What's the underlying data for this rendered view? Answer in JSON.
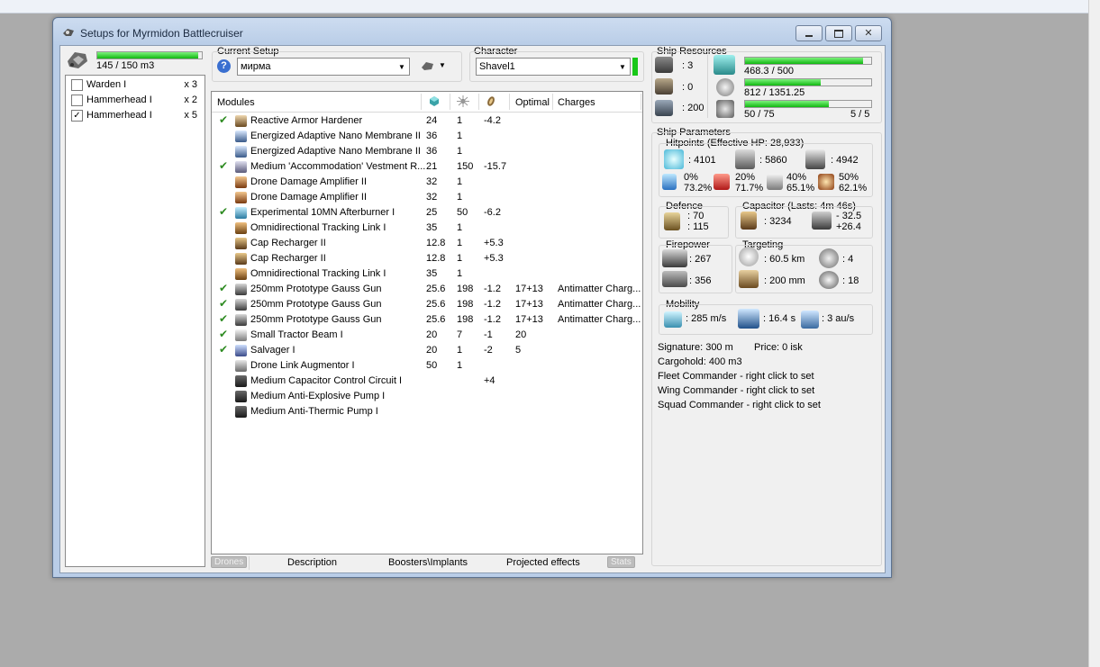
{
  "window": {
    "title": "Setups for Myrmidon Battlecruiser",
    "controls": [
      "minimize",
      "maximize",
      "close"
    ]
  },
  "drone_bay": {
    "capacity_text": "145 / 150 m3",
    "capacity_fraction": 0.967,
    "drones": [
      {
        "name": "Warden I",
        "qty": "x 3",
        "checked": false
      },
      {
        "name": "Hammerhead I",
        "qty": "x 2",
        "checked": false
      },
      {
        "name": "Hammerhead I",
        "qty": "x 5",
        "checked": true
      }
    ]
  },
  "setup": {
    "label": "Current Setup",
    "value": "мирма",
    "help_icon": "question-icon",
    "tools_icon": "drone-tools-icon"
  },
  "character": {
    "label": "Character",
    "value": "Shavel1",
    "status_color": "#18c818"
  },
  "modules": {
    "headers": {
      "name": "Modules",
      "optimal": "Optimal",
      "charges": "Charges",
      "col_icons": [
        "cpu-icon",
        "powergrid-icon",
        "capacitor-icon"
      ]
    },
    "rows": [
      {
        "active": true,
        "icon": "armor-hardener-icon",
        "name": "Reactive Armor Hardener",
        "cpu": "24",
        "pg": "1",
        "cap": "-4.2",
        "optimal": "",
        "charges": ""
      },
      {
        "active": false,
        "icon": "membrane-icon",
        "name": "Energized Adaptive Nano Membrane II",
        "cpu": "36",
        "pg": "1",
        "cap": "",
        "optimal": "",
        "charges": ""
      },
      {
        "active": false,
        "icon": "membrane-icon",
        "name": "Energized Adaptive Nano Membrane II",
        "cpu": "36",
        "pg": "1",
        "cap": "",
        "optimal": "",
        "charges": ""
      },
      {
        "active": true,
        "icon": "vestment-reconstructor-icon",
        "name": "Medium 'Accommodation' Vestment R...",
        "cpu": "21",
        "pg": "150",
        "cap": "-15.7",
        "optimal": "",
        "charges": ""
      },
      {
        "active": false,
        "icon": "drone-damage-amplifier-icon",
        "name": "Drone Damage Amplifier II",
        "cpu": "32",
        "pg": "1",
        "cap": "",
        "optimal": "",
        "charges": ""
      },
      {
        "active": false,
        "icon": "drone-damage-amplifier-icon",
        "name": "Drone Damage Amplifier II",
        "cpu": "32",
        "pg": "1",
        "cap": "",
        "optimal": "",
        "charges": ""
      },
      {
        "active": true,
        "icon": "afterburner-icon",
        "name": "Experimental 10MN Afterburner I",
        "cpu": "25",
        "pg": "50",
        "cap": "-6.2",
        "optimal": "",
        "charges": ""
      },
      {
        "active": false,
        "icon": "tracking-link-icon",
        "name": "Omnidirectional Tracking Link I",
        "cpu": "35",
        "pg": "1",
        "cap": "",
        "optimal": "",
        "charges": ""
      },
      {
        "active": false,
        "icon": "cap-recharger-icon",
        "name": "Cap Recharger II",
        "cpu": "12.8",
        "pg": "1",
        "cap": "+5.3",
        "optimal": "",
        "charges": ""
      },
      {
        "active": false,
        "icon": "cap-recharger-icon",
        "name": "Cap Recharger II",
        "cpu": "12.8",
        "pg": "1",
        "cap": "+5.3",
        "optimal": "",
        "charges": ""
      },
      {
        "active": false,
        "icon": "tracking-link-icon",
        "name": "Omnidirectional Tracking Link I",
        "cpu": "35",
        "pg": "1",
        "cap": "",
        "optimal": "",
        "charges": ""
      },
      {
        "active": true,
        "icon": "gauss-gun-icon",
        "name": "250mm Prototype Gauss Gun",
        "cpu": "25.6",
        "pg": "198",
        "cap": "-1.2",
        "optimal": "17+13",
        "charges": "Antimatter Charg..."
      },
      {
        "active": true,
        "icon": "gauss-gun-icon",
        "name": "250mm Prototype Gauss Gun",
        "cpu": "25.6",
        "pg": "198",
        "cap": "-1.2",
        "optimal": "17+13",
        "charges": "Antimatter Charg..."
      },
      {
        "active": true,
        "icon": "gauss-gun-icon",
        "name": "250mm Prototype Gauss Gun",
        "cpu": "25.6",
        "pg": "198",
        "cap": "-1.2",
        "optimal": "17+13",
        "charges": "Antimatter Charg..."
      },
      {
        "active": true,
        "icon": "tractor-beam-icon",
        "name": "Small Tractor Beam I",
        "cpu": "20",
        "pg": "7",
        "cap": "-1",
        "optimal": "20",
        "charges": ""
      },
      {
        "active": true,
        "icon": "salvager-icon",
        "name": "Salvager I",
        "cpu": "20",
        "pg": "1",
        "cap": "-2",
        "optimal": "5",
        "charges": ""
      },
      {
        "active": false,
        "icon": "drone-link-icon",
        "name": "Drone Link Augmentor I",
        "cpu": "50",
        "pg": "1",
        "cap": "",
        "optimal": "",
        "charges": ""
      },
      {
        "active": false,
        "icon": "rig-icon",
        "name": "Medium Capacitor Control Circuit I",
        "cpu": "",
        "pg": "",
        "cap": "+4",
        "optimal": "",
        "charges": ""
      },
      {
        "active": false,
        "icon": "rig-icon",
        "name": "Medium Anti-Explosive Pump I",
        "cpu": "",
        "pg": "",
        "cap": "",
        "optimal": "",
        "charges": ""
      },
      {
        "active": false,
        "icon": "rig-icon",
        "name": "Medium Anti-Thermic Pump I",
        "cpu": "",
        "pg": "",
        "cap": "",
        "optimal": "",
        "charges": ""
      }
    ]
  },
  "tabs": [
    {
      "label": "Drones",
      "enabled": false
    },
    {
      "label": "Description",
      "enabled": true
    },
    {
      "label": "Boosters\\Implants",
      "enabled": true
    },
    {
      "label": "Projected effects",
      "enabled": true
    },
    {
      "label": "Stats",
      "enabled": false
    }
  ],
  "resources": {
    "title": "Ship Resources",
    "hardpoints": {
      "turret": ": 3",
      "launcher": ": 0",
      "calibration": ": 200"
    },
    "cpu": {
      "text": "468.3 / 500",
      "fraction": 0.937
    },
    "powergrid": {
      "text": "812 / 1351.25",
      "fraction": 0.601
    },
    "drone_bandwidth": {
      "text": "50 / 75",
      "fraction": 0.667,
      "drones_active": "5 / 5"
    }
  },
  "params": {
    "title": "Ship Parameters",
    "hitpoints": {
      "title": "Hitpoints (Effective HP: 28,933)",
      "shield": ": 4101",
      "armor": ": 5860",
      "structure": ": 4942",
      "resists": [
        {
          "a": "0%",
          "b": "73.2%"
        },
        {
          "a": "20%",
          "b": "71.7%"
        },
        {
          "a": "40%",
          "b": "65.1%"
        },
        {
          "a": "50%",
          "b": "62.1%"
        }
      ]
    },
    "defence": {
      "title": "Defence",
      "a": ": 70",
      "b": ": 115"
    },
    "capacitor": {
      "title": "Capacitor (Lasts: 4m 46s)",
      "amount": ": 3234",
      "a": "- 32.5",
      "b": "+26.4"
    },
    "firepower": {
      "title": "Firepower",
      "weapon": ": 267",
      "drone": ": 356"
    },
    "targeting": {
      "title": "Targeting",
      "range": ": 60.5 km",
      "targets": ": 4",
      "sig_res": ": 200 mm",
      "scan": ": 18"
    },
    "mobility": {
      "title": "Mobility",
      "speed": ": 285 m/s",
      "align": ": 16.4 s",
      "warp": ": 3 au/s"
    },
    "signature": "Signature: 300 m",
    "price": "Price: 0 isk",
    "cargohold": "Cargohold: 400 m3",
    "fleet": "Fleet Commander - right click to set",
    "wing": "Wing Commander - right click to set",
    "squad": "Squad Commander - right click to set"
  },
  "colors": {
    "bar_fill": "#10b810",
    "check": "#2e8b22",
    "window_frame": "#b9cde7"
  }
}
